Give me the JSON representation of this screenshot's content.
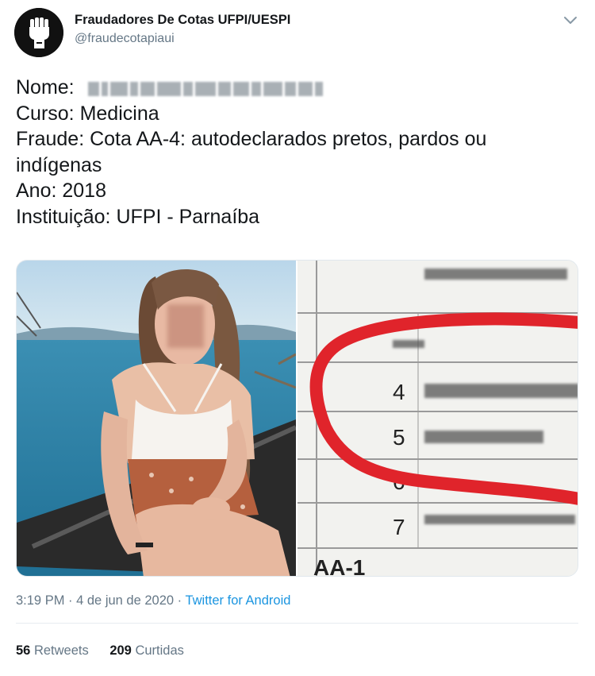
{
  "tweet": {
    "author": {
      "display_name": "Fraudadores De Cotas UFPI/UESPI",
      "handle": "@fraudecotapiaui",
      "avatar_icon": "raised-fist-icon"
    },
    "menu_icon": "chevron-down-icon",
    "lines": {
      "nome_label": "Nome:",
      "curso": "Curso: Medicina",
      "fraude_1": "Fraude: Cota AA-4: autodeclarados pretos, pardos ou",
      "fraude_2": "indígenas",
      "ano": "Ano: 2018",
      "instituicao": "Instituição: UFPI - Parnaíba"
    },
    "media": {
      "left_image": "blurred-portrait-photo",
      "right_image": "circled-list-document",
      "document_row_numbers": [
        "4",
        "5",
        "6",
        "7"
      ],
      "document_footer": "AA-1"
    },
    "meta": {
      "time": "3:19 PM",
      "separator_1": " · ",
      "date": "4 de jun de 2020",
      "separator_2": " · ",
      "source": "Twitter for Android"
    },
    "stats": {
      "retweets_count": "56",
      "retweets_label": "Retweets",
      "likes_count": "209",
      "likes_label": "Curtidas"
    },
    "colors": {
      "text": "#14171a",
      "muted": "#657786",
      "link": "#1b95e0",
      "circle_red": "#e0242b"
    }
  }
}
